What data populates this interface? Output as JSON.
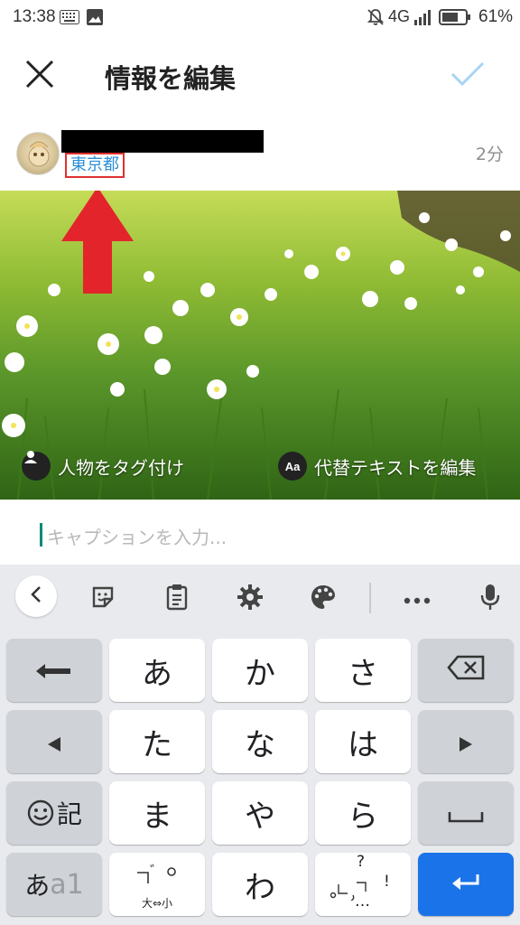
{
  "status_bar": {
    "time": "13:38",
    "network": "4G",
    "battery": "61%"
  },
  "header": {
    "title": "情報を編集"
  },
  "post": {
    "location": "東京都",
    "time_ago": "2分"
  },
  "photo": {
    "tag_people_label": "人物をタグ付け",
    "alt_text_icon": "Aa",
    "alt_text_label": "代替テキストを編集"
  },
  "caption": {
    "placeholder": "キャプションを入力..."
  },
  "keyboard": {
    "keys": {
      "a": "あ",
      "ka": "か",
      "sa": "さ",
      "ta": "た",
      "na": "な",
      "ha": "は",
      "ma": "ま",
      "ya": "や",
      "ra": "ら",
      "wa": "わ",
      "emoji_kigou": "記",
      "mode_kana": "あ",
      "mode_alpha": "a1",
      "dakuten_size": "大⇔小",
      "question": "?",
      "exclaim": "!",
      "ellipsis": "…"
    }
  },
  "colors": {
    "accent_blue": "#1a73e8",
    "location_blue": "#2f8fd8",
    "highlight_red": "#e03030",
    "check_light_blue": "#a8d4f3"
  }
}
